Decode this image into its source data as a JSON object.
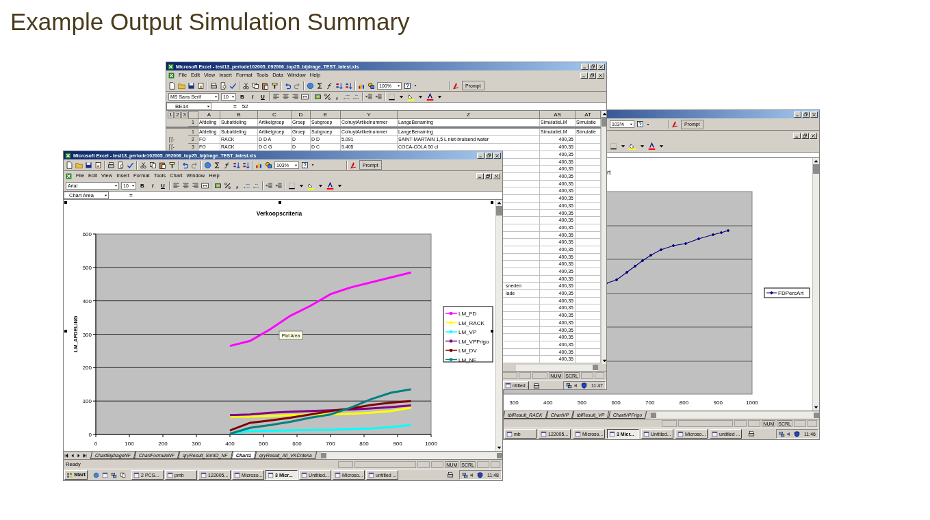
{
  "slide_title": "Example Output Simulation Summary",
  "back_window": {
    "toolbar": {
      "zoom": "103%",
      "prompt_button": "Prompt"
    },
    "chart": {
      "title_fragment": "rt",
      "x_tick_labels": [
        "300",
        "400",
        "500",
        "600",
        "700",
        "800",
        "900",
        "1000"
      ],
      "legend": [
        "FDPercArt"
      ]
    },
    "sheet_tabs": [
      {
        "label": "tblResult_RACK",
        "selected": false
      },
      {
        "label": "ChartVP",
        "selected": false
      },
      {
        "label": "tblResult_VP",
        "selected": false
      },
      {
        "label": "ChartVPFrigo",
        "selected": false
      }
    ],
    "status_bar": {
      "indicators": [
        "NUM",
        "SCRL"
      ]
    },
    "taskbar": {
      "buttons": [
        {
          "label": "mb",
          "selected": false
        },
        {
          "label": "122005...",
          "selected": false
        },
        {
          "label": "Microso...",
          "selected": false
        },
        {
          "label": "3 Micr...",
          "selected": true
        },
        {
          "label": "Untitled...",
          "selected": false
        },
        {
          "label": "Microso...",
          "selected": false
        },
        {
          "label": "untitled ...",
          "selected": false
        }
      ],
      "clock": "11:46"
    }
  },
  "middle_window": {
    "title": "Microsoft Excel - test13_periode102005_092006_top25_bijdrage_TEST_latest.xls",
    "menu": [
      "File",
      "Edit",
      "View",
      "Insert",
      "Format",
      "Tools",
      "Data",
      "Window",
      "Help"
    ],
    "toolbar": {
      "zoom": "100%",
      "prompt_button": "Prompt"
    },
    "format_toolbar": {
      "font": "MS Sans Serif",
      "size": "10",
      "style_buttons": [
        "B",
        "I",
        "U"
      ]
    },
    "name_box": "BE14",
    "formula_sign": "=",
    "formula": "52",
    "outline_levels": [
      "1",
      "2",
      "3"
    ],
    "columns": [
      "A",
      "B",
      "C",
      "D",
      "E",
      "Y",
      "Z",
      "AS",
      "AT"
    ],
    "frozen_rows": [
      {
        "header": "1",
        "cells": [
          "Afdeling",
          "Subafdeling",
          "Artikelgroep",
          "Groep",
          "Subgroep",
          "ColruytArtikelnummer",
          "LangeBenaming",
          "SimulatieLM",
          "Simulatie"
        ]
      }
    ],
    "rows": [
      {
        "header": "1",
        "cells": [
          "Afdeling",
          "Subafdeling",
          "Artikelgroep",
          "Groep",
          "Subgroep",
          "ColruytArtikelnummer",
          "LangeBenaming",
          "SimulatieLM",
          "Simulatie"
        ]
      },
      {
        "header": "2",
        "cells": [
          "FO",
          "RACK",
          "D D A",
          "D",
          "D D",
          "5.091",
          "SAINT-MARTAIN 1,5 L niet-bruisend water",
          "400,35"
        ]
      },
      {
        "header": "3",
        "cells": [
          "FO",
          "RACK",
          "D C G",
          "D",
          "D C",
          "5.405",
          "COCA-COLA 50 cl",
          "400,35"
        ]
      }
    ],
    "lower_rows": [
      {
        "simulatie_lm": "400,35"
      },
      {
        "simulatie_lm": "400,35"
      },
      {
        "simulatie_lm": "400,35"
      },
      {
        "simulatie_lm": "400,35"
      },
      {
        "simulatie_lm": "400,35"
      },
      {
        "simulatie_lm": "400,35"
      },
      {
        "simulatie_lm": "400,35"
      },
      {
        "simulatie_lm": "400,35"
      },
      {
        "simulatie_lm": "400,35"
      },
      {
        "simulatie_lm": "400,35"
      },
      {
        "simulatie_lm": "400,35"
      },
      {
        "simulatie_lm": "400,35"
      },
      {
        "simulatie_lm": "400,35"
      },
      {
        "simulatie_lm": "400,35"
      },
      {
        "simulatie_lm": "400,35"
      },
      {
        "simulatie_lm": "400,35"
      },
      {
        "simulatie_lm": "400,35"
      },
      {
        "simulatie_lm": "400,35"
      },
      {
        "lange_benaming": "sneden",
        "simulatie_lm": "400,35"
      },
      {
        "lange_benaming": "lade",
        "simulatie_lm": "400,35"
      },
      {
        "simulatie_lm": "400,35"
      },
      {
        "simulatie_lm": "400,35"
      },
      {
        "simulatie_lm": "400,35"
      },
      {
        "simulatie_lm": "400,35"
      },
      {
        "simulatie_lm": "400,35"
      },
      {
        "simulatie_lm": "400,35"
      },
      {
        "simulatie_lm": "400,35"
      },
      {
        "simulatie_lm": "400,35"
      },
      {
        "simulatie_lm": "400,35"
      }
    ],
    "status_bar": {
      "indicators": [
        "NUM",
        "SCRL"
      ]
    },
    "taskbar": {
      "buttons": [
        {
          "label": "ntitled ...",
          "selected": false
        }
      ],
      "clock": "11:47"
    }
  },
  "front_window": {
    "title": "Microsoft Excel - test13_periode102005_092006_top25_bijdrage_TEST_latest.xls",
    "toolbar": {
      "zoom": "103%",
      "prompt_button": "Prompt"
    },
    "menu": [
      "File",
      "Edit",
      "View",
      "Insert",
      "Format",
      "Tools",
      "Chart",
      "Window",
      "Help"
    ],
    "format_toolbar": {
      "font": "Arial",
      "size": "10",
      "style_buttons": [
        "B",
        "I",
        "U"
      ]
    },
    "name_box": "Chart Area",
    "formula_sign": "=",
    "chart": {
      "tooltip": "Plot Area",
      "chart_data": {
        "type": "line",
        "title": "Verkoopscriteria",
        "ylabel": "LM_AFDELING",
        "x": [
          400,
          460,
          520,
          580,
          640,
          700,
          760,
          820,
          880,
          940
        ],
        "series": [
          {
            "name": "LM_FD",
            "color": "#ff00ff",
            "values": [
              265,
              280,
              315,
              355,
              385,
              420,
              440,
              455,
              470,
              485
            ]
          },
          {
            "name": "LM_RACK",
            "color": "#ffff00",
            "values": [
              53,
              53,
              55,
              58,
              60,
              60,
              62,
              65,
              70,
              80
            ]
          },
          {
            "name": "LM_VP",
            "color": "#00ffff",
            "values": [
              3,
              10,
              11,
              12,
              14,
              14,
              16,
              18,
              22,
              28
            ]
          },
          {
            "name": "LM_VPFrigo",
            "color": "#800080",
            "values": [
              58,
              60,
              65,
              68,
              70,
              72,
              75,
              78,
              82,
              87
            ]
          },
          {
            "name": "LM_DV",
            "color": "#800000",
            "values": [
              12,
              35,
              42,
              50,
              60,
              70,
              78,
              88,
              95,
              100
            ]
          },
          {
            "name": "LM_NF",
            "color": "#008080",
            "values": [
              2,
              20,
              28,
              38,
              50,
              60,
              80,
              105,
              125,
              135
            ]
          }
        ],
        "grid": true,
        "legend": "right",
        "xlim": [
          0,
          1000
        ],
        "ylim": [
          0,
          600
        ],
        "xticks": [
          0,
          100,
          200,
          300,
          400,
          500,
          600,
          700,
          800,
          900,
          1000
        ],
        "yticks": [
          0,
          100,
          200,
          300,
          400,
          500,
          600
        ]
      }
    },
    "sheet_tabs": [
      {
        "label": "ChartBijdrageNF",
        "selected": false
      },
      {
        "label": "ChartFormuleNF",
        "selected": false
      },
      {
        "label": "qryResult_SimID_NF",
        "selected": false
      },
      {
        "label": "Chart1",
        "selected": true
      },
      {
        "label": "qryResult_All_VKCriteria",
        "selected": false
      }
    ],
    "status_bar": {
      "text": "Ready",
      "indicators": [
        "NUM",
        "SCRL"
      ]
    },
    "taskbar": {
      "start": "Start",
      "buttons": [
        {
          "label": "2 PCS...",
          "selected": false
        },
        {
          "label": "pmb",
          "selected": false
        },
        {
          "label": "122005...",
          "selected": false
        },
        {
          "label": "Microso...",
          "selected": false
        },
        {
          "label": "3 Micr...",
          "selected": true
        },
        {
          "label": "Untitled...",
          "selected": false
        },
        {
          "label": "Microso...",
          "selected": false
        },
        {
          "label": "untitled ...",
          "selected": false
        }
      ],
      "clock": "11:48"
    }
  }
}
